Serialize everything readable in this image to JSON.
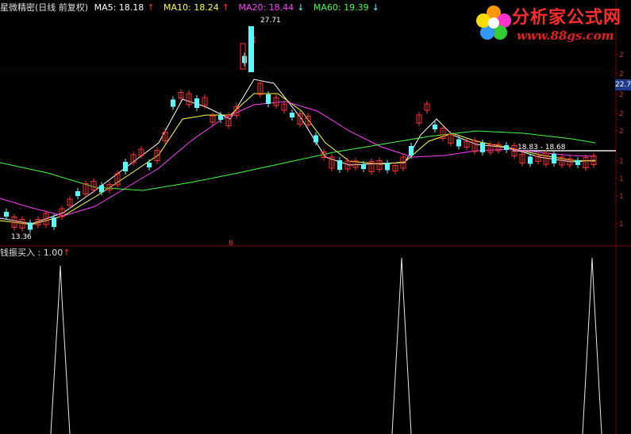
{
  "header": {
    "title": "星微精密(日线 前复权)",
    "ma5_label": "MA5: 18.18",
    "ma5_arrow": "↑",
    "ma10_label": "MA10: 18.24",
    "ma10_arrow": "↑",
    "ma20_label": "MA20: 18.44",
    "ma20_arrow": "↓",
    "ma60_label": "MA60: 19.39",
    "ma60_arrow": "↓"
  },
  "indicator": {
    "label": "钱振买入 : 1.00",
    "arrow": "↑"
  },
  "annotations": {
    "high": "27.71",
    "low": "13.36",
    "range": "18.83 - 18.68",
    "marker": "8"
  },
  "price_tag": "22.7",
  "axis_ticks": [
    "2",
    "2",
    "2",
    "2",
    "2",
    "1",
    "1",
    "1",
    "1"
  ],
  "logo": {
    "title": "分析家公式网",
    "url": "www.88gs.com"
  },
  "colors": {
    "up": "#ff3030",
    "down": "#54ffff",
    "ma5": "#ffffff",
    "ma10": "#ffff40",
    "ma20": "#ff40ff",
    "ma60": "#40ff40",
    "grid": "#800000"
  }
}
